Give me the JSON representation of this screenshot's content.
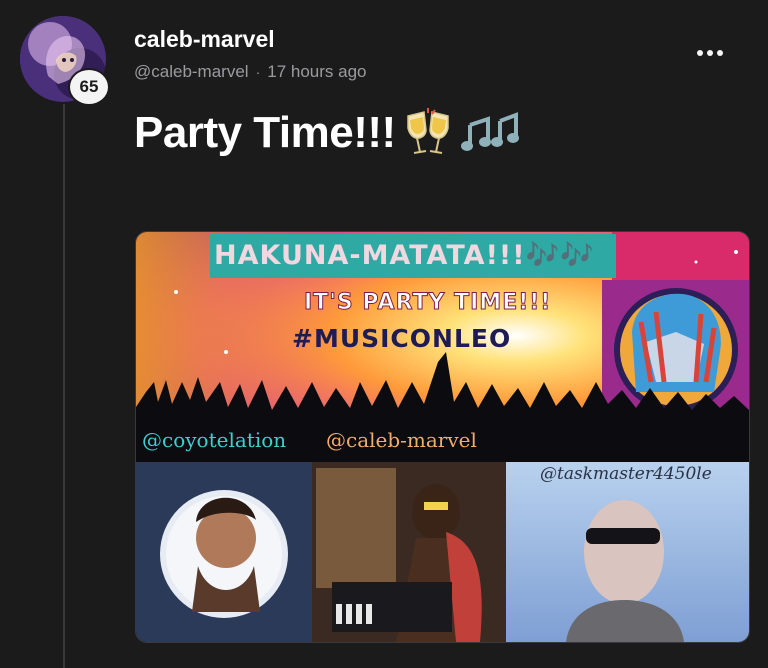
{
  "author": {
    "username": "caleb-marvel",
    "handle": "@caleb-marvel",
    "reputation": "65",
    "time_ago": "17 hours ago",
    "avatar_icon": "lion-avatar"
  },
  "post": {
    "title": "Party Time!!!",
    "title_emojis": [
      "clinking-glasses-emoji",
      "music-notes-emoji"
    ],
    "image": {
      "banner_text": "HAKUNA-MATATA!!!🎶🎶",
      "party_text": "IT'S PARTY TIME!!!",
      "hashtag_text": "#MUSICONLEO",
      "handle_left": "@coyotelation",
      "handle_middle": "@caleb-marvel",
      "handle_right": "@taskmaster4450le"
    }
  },
  "colors": {
    "background": "#1b1b1c",
    "meta_text": "#9b9b9f",
    "banner_teal": "#2fa9a3"
  }
}
